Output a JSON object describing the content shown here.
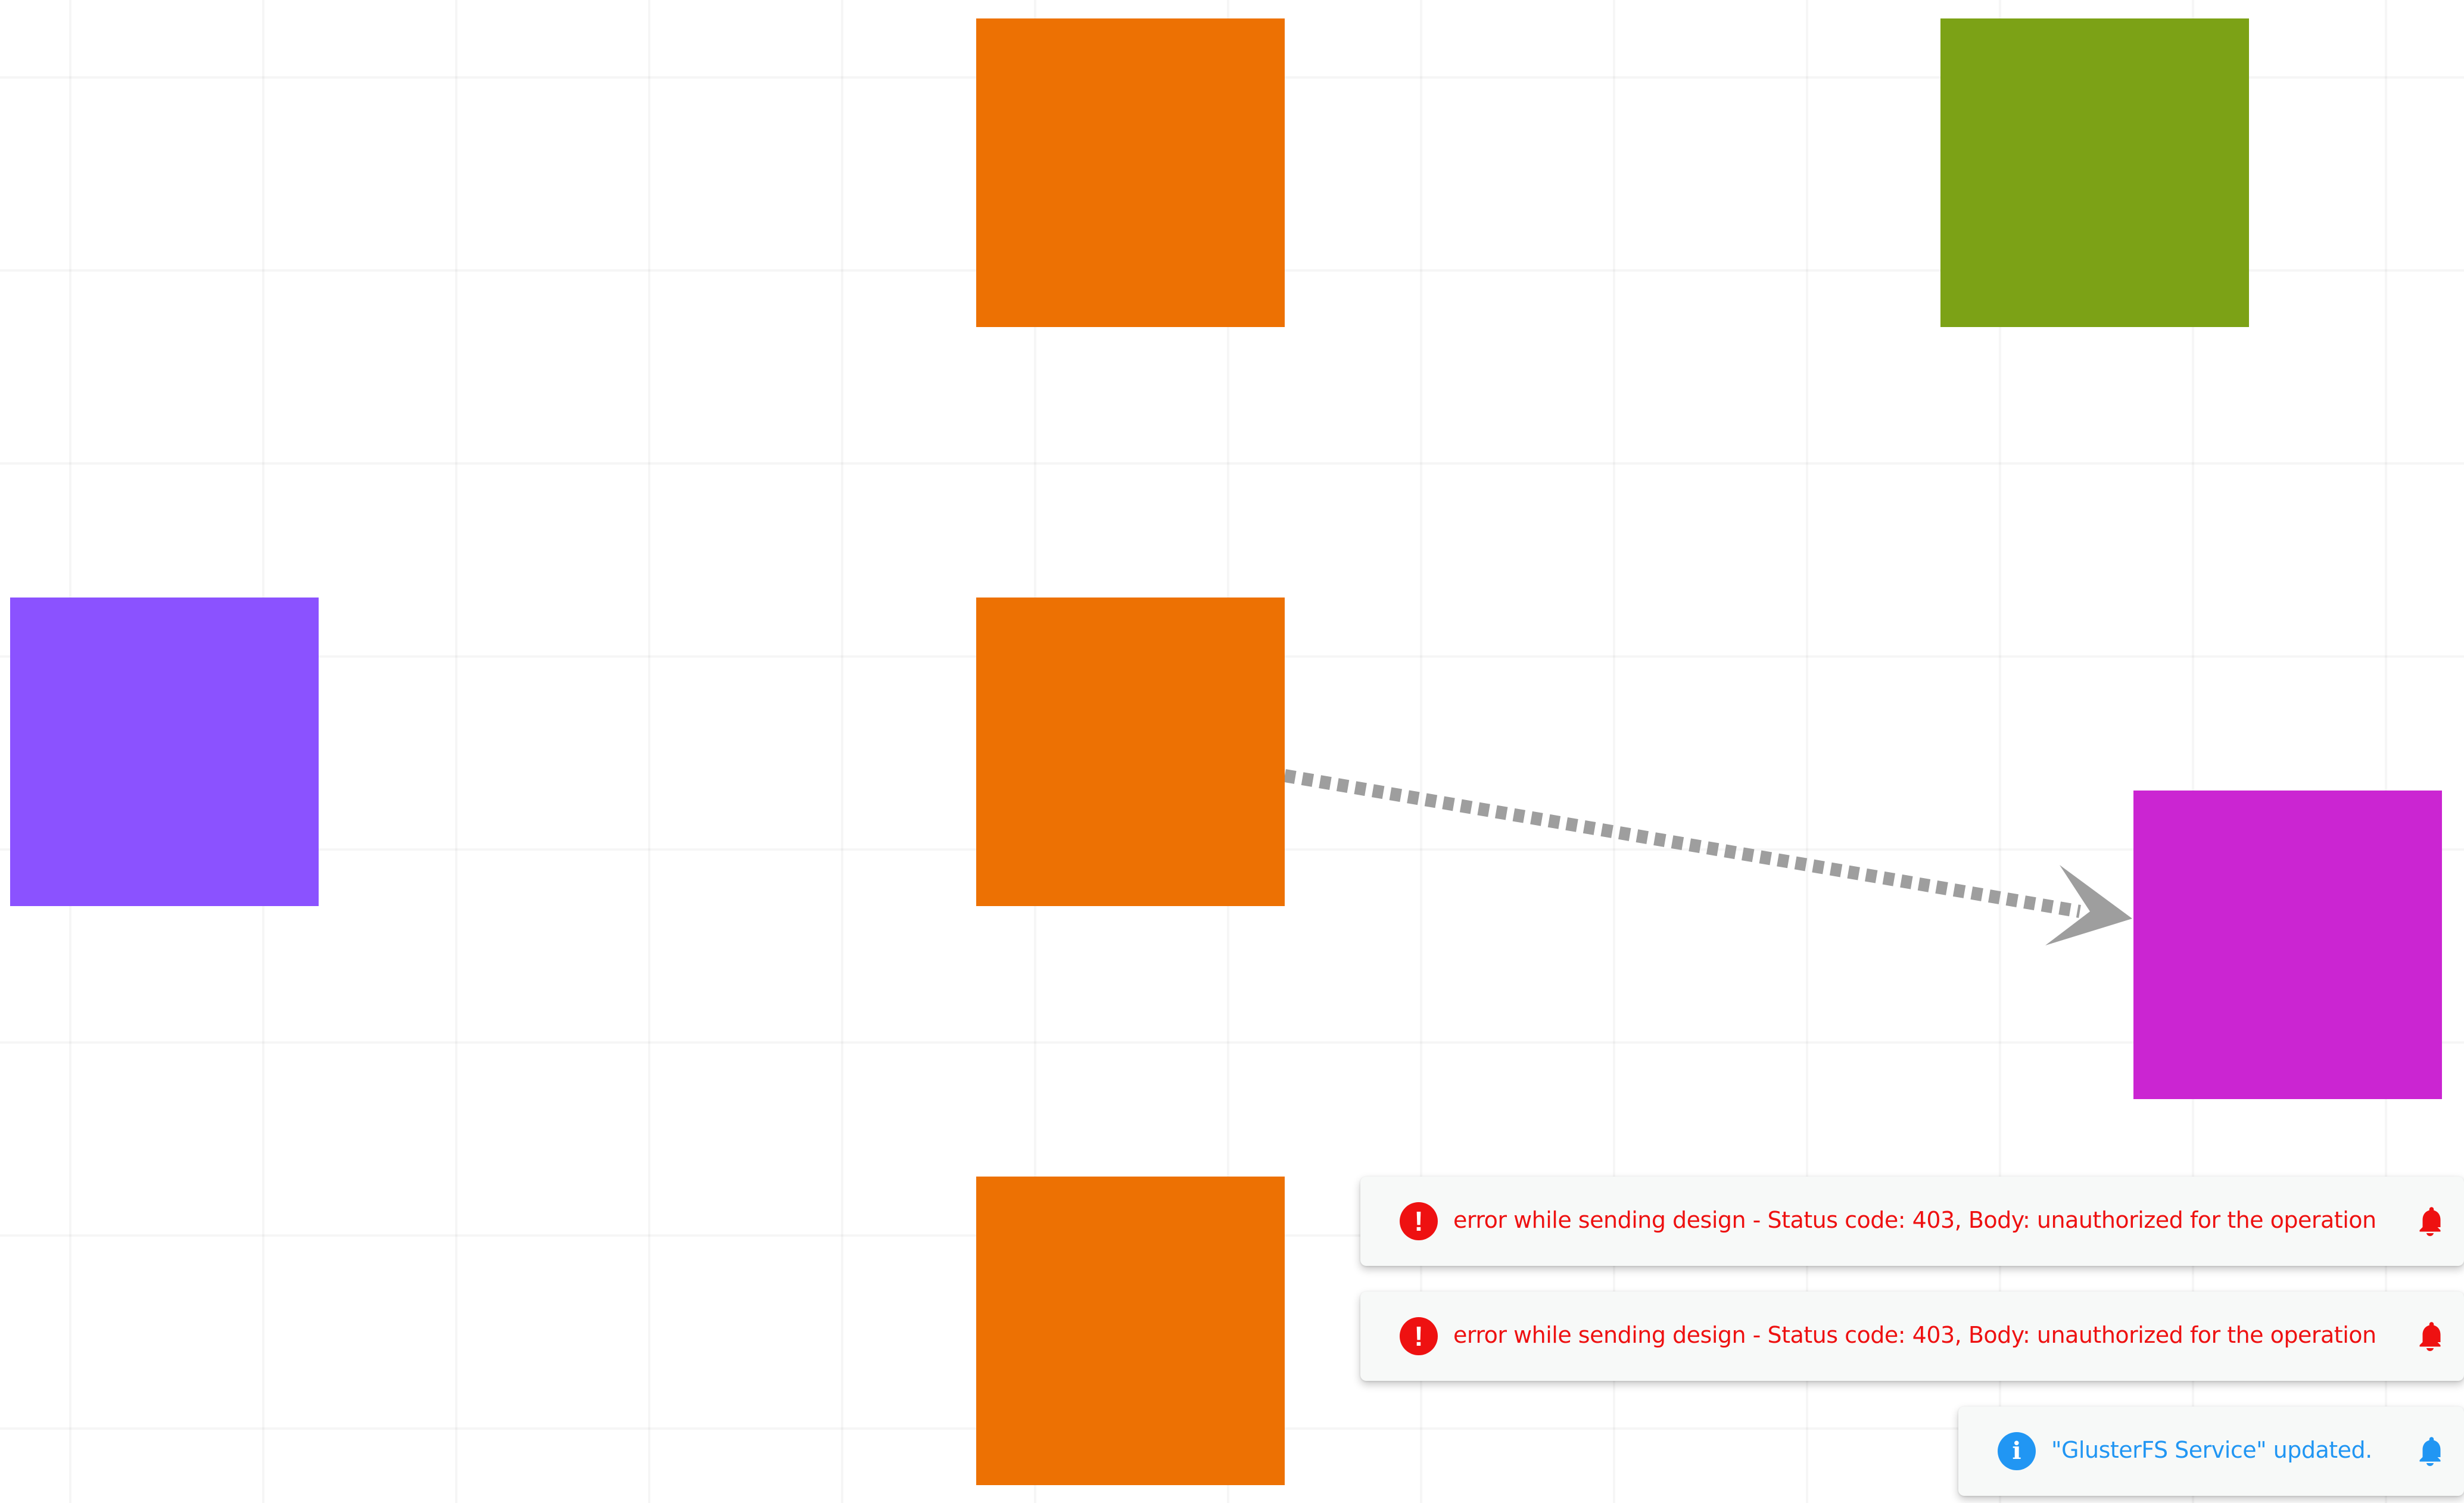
{
  "canvas": {
    "nodes": [
      {
        "id": "node-orange-top",
        "color": "#ed7103"
      },
      {
        "id": "node-green-top-right",
        "color": "#7ca216"
      },
      {
        "id": "node-purple-left",
        "color": "#8b52ff"
      },
      {
        "id": "node-orange-middle",
        "color": "#ed7103"
      },
      {
        "id": "node-magenta-right",
        "color": "#cb25d2"
      },
      {
        "id": "node-orange-bottom",
        "color": "#ed7103"
      }
    ],
    "edges": [
      {
        "from": "node-orange-middle",
        "to": "node-magenta-right",
        "style": "dashed",
        "color": "#9e9e9e"
      }
    ]
  },
  "notifications": [
    {
      "type": "error",
      "icon": "error-icon",
      "message": "error while sending design - Status code: 403, Body: unauthorized for the operation",
      "color": "#ee1111"
    },
    {
      "type": "error",
      "icon": "error-icon",
      "message": "error while sending design - Status code: 403, Body: unauthorized for the operation",
      "color": "#ee1111"
    },
    {
      "type": "info",
      "icon": "info-icon",
      "message": "\"GlusterFS Service\" updated.",
      "color": "#2196f3"
    }
  ]
}
